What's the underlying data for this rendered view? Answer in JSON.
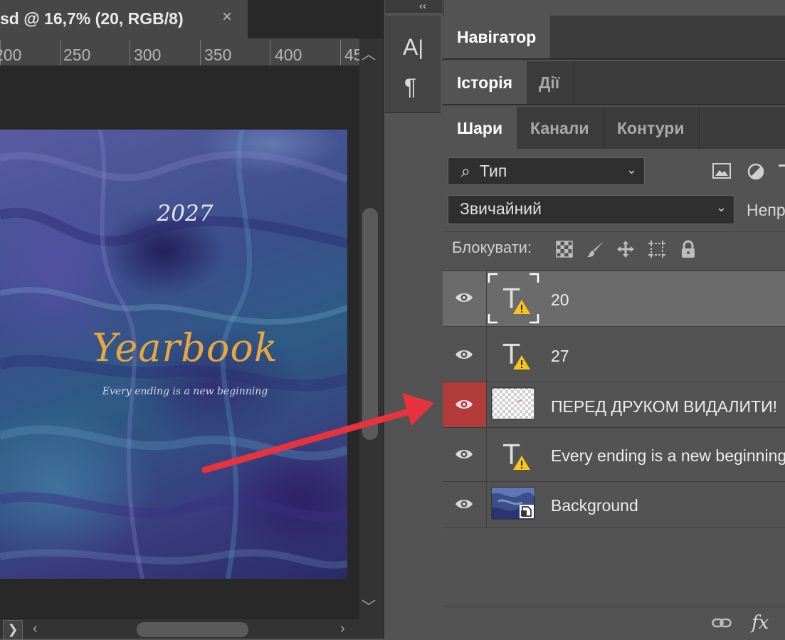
{
  "document": {
    "tab_title": "sd @ 16,7% (20, RGB/8)",
    "close_symbol": "×",
    "ruler_ticks": [
      "200",
      "250",
      "300",
      "350",
      "400",
      "45"
    ],
    "artboard": {
      "year": "2027",
      "title": "Yearbook",
      "subtitle": "Every ending is a new beginning"
    }
  },
  "tool_strip": {
    "collapse_symbol": "‹‹",
    "character_glyph": "A",
    "paragraph_glyph": "¶"
  },
  "panels": {
    "navigator": {
      "tabs": [
        {
          "label": "Навігатор"
        }
      ]
    },
    "history": {
      "tabs": [
        {
          "label": "Історія"
        },
        {
          "label": "Дії"
        }
      ]
    },
    "layers": {
      "tabs": [
        {
          "label": "Шари"
        },
        {
          "label": "Канали"
        },
        {
          "label": "Контури"
        }
      ],
      "filter": {
        "search_symbol": "⌕",
        "value": "Тип"
      },
      "blend_mode": "Звичайний",
      "opacity_label": "Непр",
      "lock_label": "Блокувати:",
      "items": [
        {
          "name": "20",
          "type": "text",
          "selected": true,
          "warning": true
        },
        {
          "name": "27",
          "type": "text",
          "selected": false,
          "warning": true
        },
        {
          "name": "ПЕРЕД ДРУКОМ ВИДАЛИТИ!",
          "type": "raster",
          "selected": false,
          "highlighted_eye": true
        },
        {
          "name": "Every ending is a new beginning",
          "type": "text",
          "selected": false,
          "warning": true
        },
        {
          "name": "Background",
          "type": "smart-object",
          "selected": false
        }
      ],
      "footer": {
        "fx_label": "fx"
      }
    }
  },
  "colors": {
    "selected_layer": "#6b6b6b",
    "eye_highlight": "#b23c3c",
    "annotation_arrow": "#e8333f",
    "warning": "#f5c518"
  }
}
